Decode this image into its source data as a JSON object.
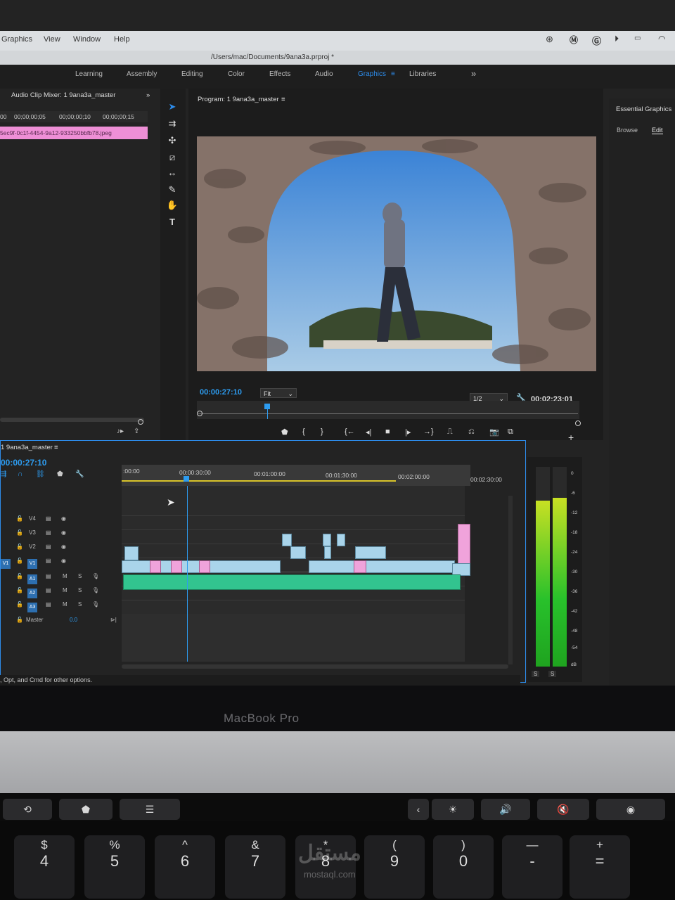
{
  "menubar": {
    "items": [
      "Graphics",
      "View",
      "Window",
      "Help"
    ]
  },
  "titlebar": {
    "path": "/Users/mac/Documents/9ana3a.prproj *"
  },
  "workspaces": {
    "items": [
      "Learning",
      "Assembly",
      "Editing",
      "Color",
      "Effects",
      "Audio",
      "Graphics",
      "Libraries"
    ],
    "active": "Graphics",
    "more": "»"
  },
  "left_panel": {
    "title": "Audio Clip Mixer: 1 9ana3a_master",
    "ruler": [
      "00",
      "00;00;00;05",
      "00;00;00;10",
      "00;00;00;15"
    ],
    "clip_label": "5ec9f-0c1f-4454-9a12-933250bbfb78.jpeg"
  },
  "program": {
    "title": "Program: 1 9ana3a_master",
    "timecode_current": "00:00:27:10",
    "zoom": "Fit",
    "resolution": "1/2",
    "timecode_duration": "00:02:23:01"
  },
  "essential_graphics": {
    "title": "Essential Graphics",
    "tabs": [
      "Browse",
      "Edit"
    ],
    "active_tab": "Edit"
  },
  "timeline": {
    "title": "1 9ana3a_master",
    "timecode": "00:00:27:10",
    "ruler_labels": [
      ":00:00",
      "00:00:30:00",
      "00:01:00:00",
      "00:01:30:00",
      "00:02:00:00",
      "00:02:30:00"
    ],
    "video_tracks": [
      "V4",
      "V3",
      "V2",
      "V1"
    ],
    "audio_tracks": [
      "A1",
      "A2",
      "A3"
    ],
    "master": {
      "label": "Master",
      "value": "0.0"
    },
    "source_patch": "V1"
  },
  "meters": {
    "labels": [
      "0",
      "-6",
      "-12",
      "-18",
      "-24",
      "-30",
      "-36",
      "-42",
      "-48",
      "-54",
      "dB"
    ],
    "solo": [
      "S",
      "S"
    ]
  },
  "status_bar": {
    "text": ", Opt, and Cmd for other options."
  },
  "laptop": {
    "brand": "MacBook Pro"
  },
  "touchbar": {
    "keys": [
      "⟲",
      "⬟",
      "☰",
      "‹",
      "☀",
      "🔊",
      "🔇",
      "◉"
    ]
  },
  "keyboard": {
    "keys": [
      {
        "top": "$",
        "bot": "4"
      },
      {
        "top": "%",
        "bot": "5"
      },
      {
        "top": "^",
        "bot": "6"
      },
      {
        "top": "&",
        "bot": "7"
      },
      {
        "top": "*",
        "bot": "8"
      },
      {
        "top": "(",
        "bot": "9"
      },
      {
        "top": ")",
        "bot": "0"
      },
      {
        "top": "—",
        "bot": "-"
      },
      {
        "top": "+",
        "bot": "="
      }
    ]
  },
  "watermark": {
    "arabic": "مستقل",
    "latin": "mostaql.com"
  }
}
